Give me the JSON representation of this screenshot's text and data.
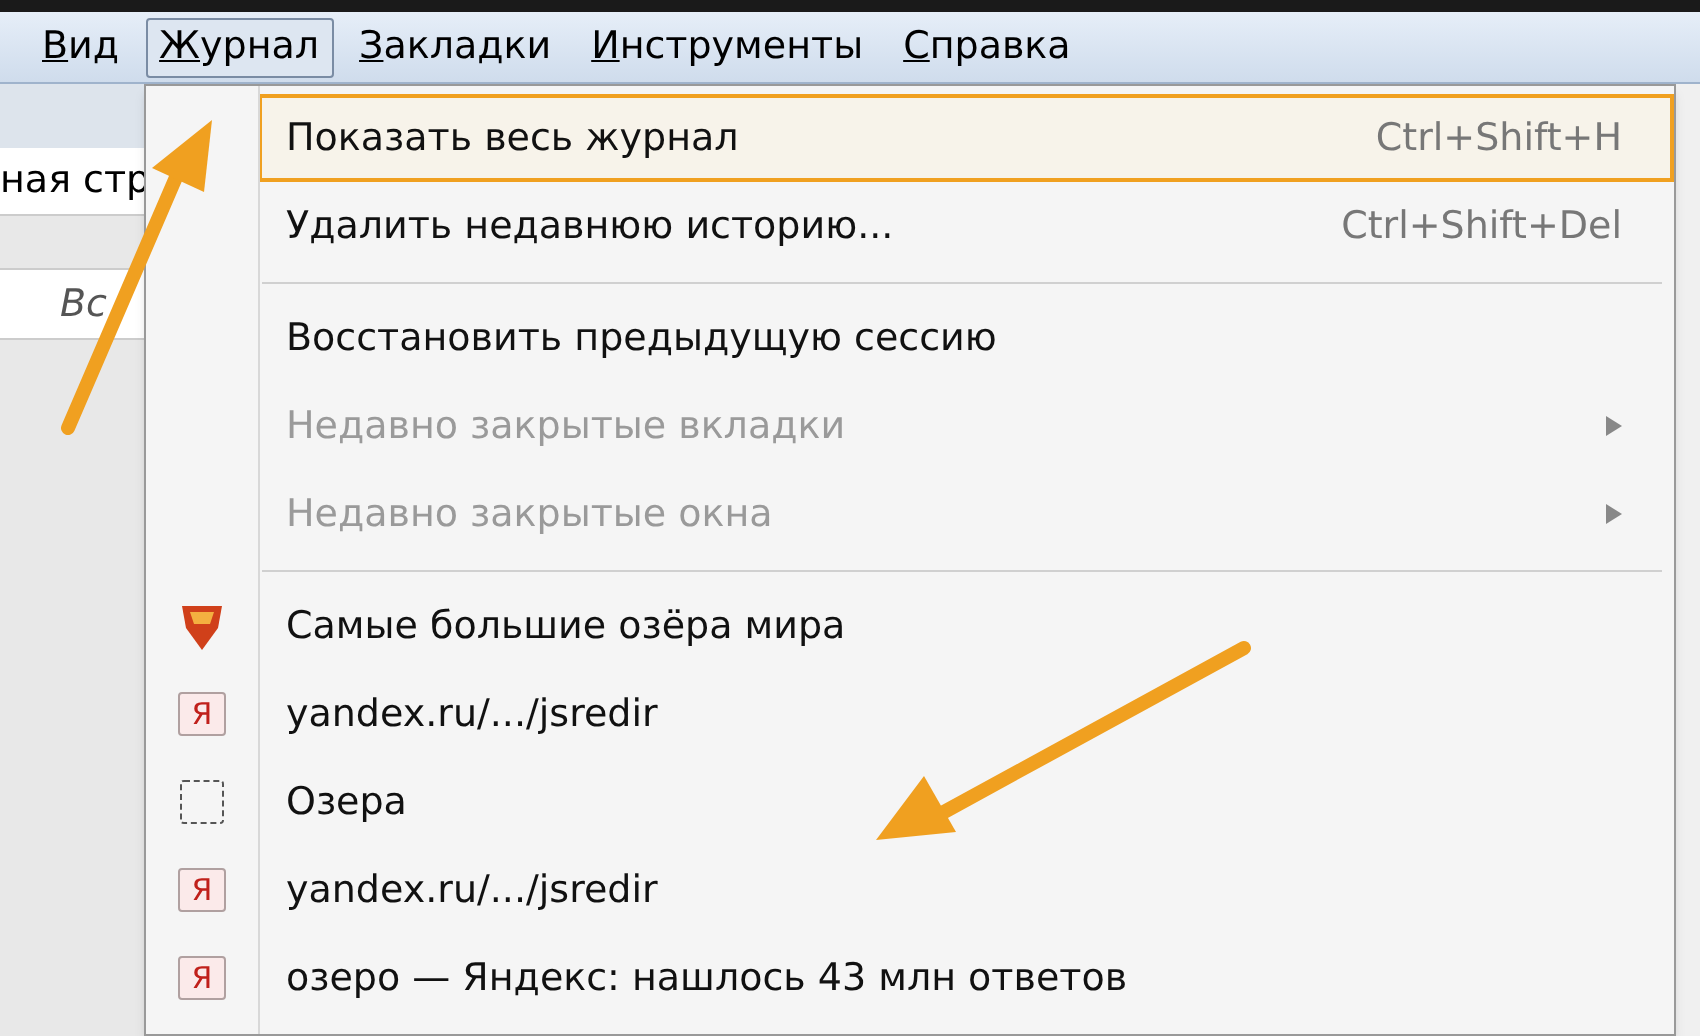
{
  "menu_bar": [
    {
      "label": "Вид",
      "underline_first": true,
      "selected": false
    },
    {
      "label": "Журнал",
      "underline_first": true,
      "selected": true
    },
    {
      "label": "Закладки",
      "underline_first": true,
      "selected": false
    },
    {
      "label": "Инструменты",
      "underline_first": true,
      "selected": false
    },
    {
      "label": "Справка",
      "underline_first": true,
      "selected": false
    }
  ],
  "background": {
    "tab_title": "ная стр",
    "toolbar_text": "Вс"
  },
  "menu": {
    "groups": [
      [
        {
          "label": "Показать весь журнал",
          "shortcut": "Ctrl+Shift+H",
          "selected": true,
          "disabled": false,
          "has_submenu": false
        },
        {
          "label": "Удалить недавнюю историю...",
          "shortcut": "Ctrl+Shift+Del",
          "selected": false,
          "disabled": false,
          "has_submenu": false
        }
      ],
      [
        {
          "label": "Восстановить предыдущую сессию",
          "selected": false,
          "disabled": false,
          "has_submenu": false
        },
        {
          "label": "Недавно закрытые вкладки",
          "selected": false,
          "disabled": true,
          "has_submenu": true
        },
        {
          "label": "Недавно закрытые окна",
          "selected": false,
          "disabled": true,
          "has_submenu": true
        }
      ]
    ],
    "history": [
      {
        "kind": "site",
        "label": "Самые большие озёра мира"
      },
      {
        "kind": "yandex",
        "icon_text": "Я",
        "label": "yandex.ru/.../jsredir"
      },
      {
        "kind": "blank",
        "label": "Озера"
      },
      {
        "kind": "yandex",
        "icon_text": "Я",
        "label": "yandex.ru/.../jsredir"
      },
      {
        "kind": "yandex",
        "icon_text": "Я",
        "label": "озеро — Яндекс: нашлось 43 млн ответов"
      }
    ]
  }
}
